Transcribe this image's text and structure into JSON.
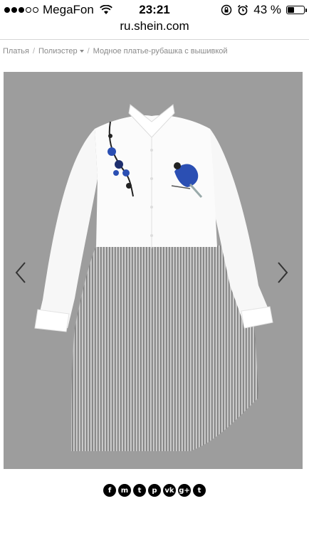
{
  "status_bar": {
    "carrier": "MegaFon",
    "signal_bars_filled": 3,
    "signal_bars_total": 5,
    "time": "23:21",
    "battery": "43 %",
    "battery_level": 0.43,
    "icons": [
      "signal-icon",
      "wifi-icon",
      "rotation-lock-icon",
      "alarm-icon",
      "battery-icon"
    ]
  },
  "browser": {
    "url": "ru.shein.com"
  },
  "breadcrumb": {
    "items": [
      "Платья",
      "Полиэстер",
      "Модное платье-рубашка с вышивкой"
    ],
    "separator": "/"
  },
  "gallery": {
    "prev_icon": "chevron-left-icon",
    "next_icon": "chevron-right-icon"
  },
  "share": {
    "icons": [
      {
        "name": "facebook-icon",
        "glyph": "f"
      },
      {
        "name": "messenger-icon",
        "glyph": "m"
      },
      {
        "name": "twitter-icon",
        "glyph": "t"
      },
      {
        "name": "pinterest-icon",
        "glyph": "p"
      },
      {
        "name": "vk-icon",
        "glyph": "vk"
      },
      {
        "name": "google-plus-icon",
        "glyph": "g+"
      },
      {
        "name": "tumblr-icon",
        "glyph": "t"
      }
    ]
  },
  "colors": {
    "background": "#ffffff",
    "photo_background": "#9d9d9d",
    "breadcrumb_text": "#8a8a8a",
    "bird_blue": "#2b4fb3"
  }
}
